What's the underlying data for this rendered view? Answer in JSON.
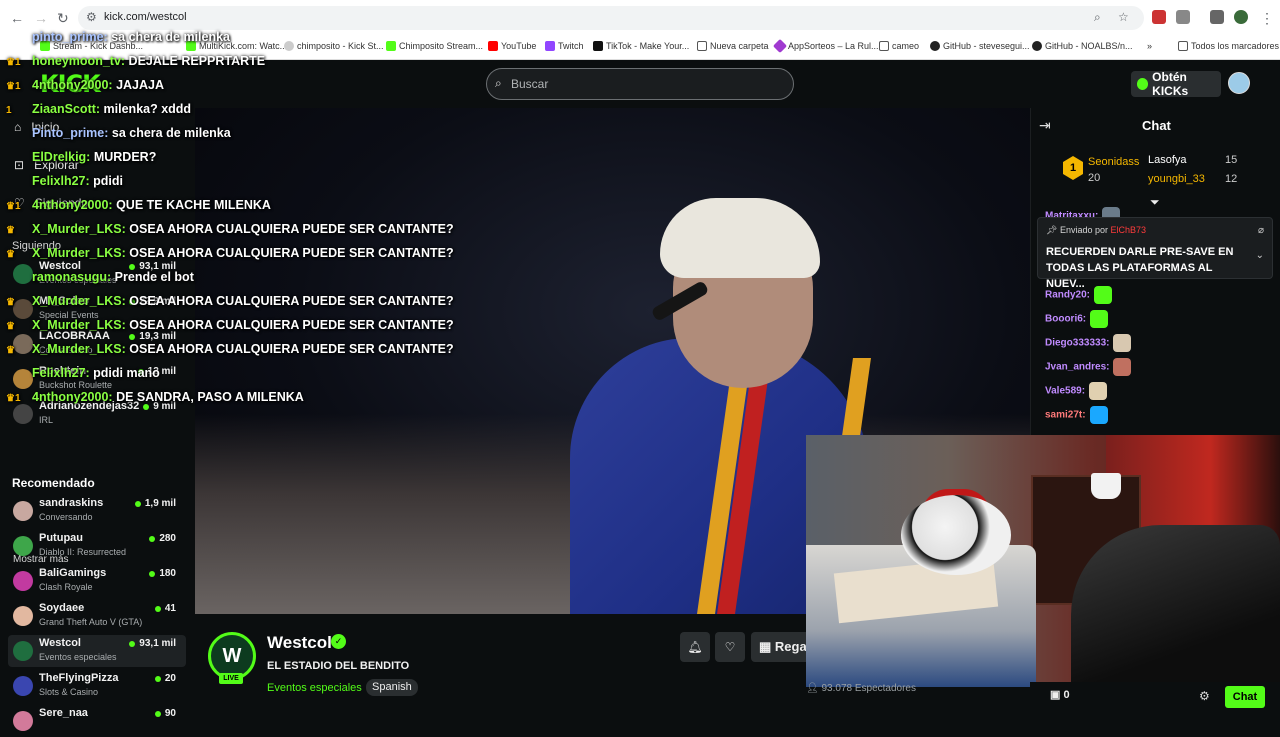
{
  "browser": {
    "url": "kick.com/westcol",
    "bookmarks": [
      "Stream - Kick Dashb...",
      "MultiKick.com: Watc...",
      "chimposito - Kick St...",
      "Chimposito Stream...",
      "YouTube",
      "Twitch",
      "TikTok - Make Your...",
      "Nueva carpeta",
      "AppSorteos – La Rul...",
      "cameo",
      "GitHub - stevesegui...",
      "GitHub - NOALBS/n...",
      "Todos los marcadores"
    ]
  },
  "header": {
    "logo": "KICK",
    "search_placeholder": "Buscar",
    "get_kicks_label": "Obtén KICKs"
  },
  "sidebar": {
    "nav": [
      {
        "label": "Inicio",
        "icon": "home-icon"
      },
      {
        "label": "Explorar",
        "icon": "explore-icon"
      },
      {
        "label": "Siguiendo",
        "icon": "heart-icon"
      }
    ],
    "following_heading": "Siguiendo",
    "following": [
      {
        "name": "Westcol",
        "category": "Eventos especiales",
        "viewers": "93,1 mil",
        "color": "#1f6e3f"
      },
      {
        "name": "Mr_Soloo",
        "category": "Special Events",
        "viewers": "22,9 mil",
        "color": "#5a4a3a"
      },
      {
        "name": "LACOBRAAA",
        "category": "Conversando",
        "viewers": "19,3 mil",
        "color": "#7a6a5a"
      },
      {
        "name": "Roshtein",
        "category": "Buckshot Roulette",
        "viewers": "12 mil",
        "color": "#b5843a"
      },
      {
        "name": "Adrianozendejas32",
        "category": "IRL",
        "viewers": "9 mil",
        "color": "#444"
      }
    ],
    "show_more": "Mostrar más",
    "recommended_heading": "Recomendado",
    "recommended": [
      {
        "name": "sandraskins",
        "category": "Conversando",
        "viewers": "1,9 mil",
        "color": "#c8a8a0",
        "selected": false
      },
      {
        "name": "Putupau",
        "category": "Diablo II: Resurrected",
        "viewers": "280",
        "color": "#3ea64a",
        "selected": false
      },
      {
        "name": "BaliGamings",
        "category": "Clash Royale",
        "viewers": "180",
        "color": "#c23aa0",
        "selected": false
      },
      {
        "name": "Soydaee",
        "category": "Grand Theft Auto V (GTA)",
        "viewers": "41",
        "color": "#e2b8a0",
        "selected": false
      },
      {
        "name": "Westcol",
        "category": "Eventos especiales",
        "viewers": "93,1 mil",
        "color": "#1f6e3f",
        "selected": true
      },
      {
        "name": "TheFlyingPizza",
        "category": "Slots & Casino",
        "viewers": "20",
        "color": "#3a46b0",
        "selected": false
      },
      {
        "name": "Sere_naa",
        "category": "",
        "viewers": "90",
        "color": "#d27a9a",
        "selected": false
      }
    ]
  },
  "overlay_chat": [
    {
      "user": "pinto_prime:",
      "msg": "sa chera de milenka",
      "badges": "",
      "blue": true
    },
    {
      "user": "honeymoon_tv:",
      "msg": "DEJALE REPPRTARTE",
      "badges": "♛1",
      "blue": false
    },
    {
      "user": "4nthony2000:",
      "msg": "JAJAJA",
      "badges": "♛1",
      "blue": false
    },
    {
      "user": "ZiaanScott:",
      "msg": "milenka? xddd",
      "badges": "1",
      "blue": false
    },
    {
      "user": "Pinto_prime:",
      "msg": "sa chera de milenka",
      "badges": "",
      "blue": true
    },
    {
      "user": "ElDrelkig:",
      "msg": "MURDER?",
      "badges": "",
      "blue": false
    },
    {
      "user": "Felixlh27:",
      "msg": "pdidi",
      "badges": "",
      "blue": false
    },
    {
      "user": "4nthony2000:",
      "msg": "QUE TE KACHE MILENKA",
      "badges": "♛1",
      "blue": false
    },
    {
      "user": "X_Murder_LKS:",
      "msg": "OSEA AHORA CUALQUIERA PUEDE SER CANTANTE?",
      "badges": "♛",
      "blue": false
    },
    {
      "user": "X_Murder_LKS:",
      "msg": "OSEA AHORA CUALQUIERA PUEDE SER CANTANTE?",
      "badges": "♛",
      "blue": false
    },
    {
      "user": "ramonasugu:",
      "msg": "Prende el bot",
      "badges": "",
      "blue": false
    },
    {
      "user": "X_Murder_LKS:",
      "msg": "OSEA AHORA CUALQUIERA PUEDE SER CANTANTE?",
      "badges": "♛",
      "blue": false
    },
    {
      "user": "X_Murder_LKS:",
      "msg": "OSEA AHORA CUALQUIERA PUEDE SER CANTANTE?",
      "badges": "♛",
      "blue": false
    },
    {
      "user": "X_Murder_LKS:",
      "msg": "OSEA AHORA CUALQUIERA PUEDE SER CANTANTE?",
      "badges": "♛",
      "blue": false
    },
    {
      "user": "Felixlh27:",
      "msg": "pdidi mano",
      "badges": "",
      "blue": false
    },
    {
      "user": "4nthony2000:",
      "msg": "DE SANDRA, PASO A MILENKA",
      "badges": "♛1",
      "blue": false
    }
  ],
  "stream": {
    "avatar_letters": "W",
    "live_label": "LIVE",
    "streamer": "Westcol",
    "title": "EL ESTADIO DEL BENDITO",
    "category": "Eventos especiales",
    "language": "Spanish",
    "gift_label": "Regalar",
    "viewers_text": "93.078 Espectadores"
  },
  "chat": {
    "title": "Chat",
    "top_gifters": [
      {
        "rank": "1",
        "name": "Seonidass",
        "value": "20"
      },
      {
        "name": "Lasofya",
        "value": "15"
      },
      {
        "name": "youngbi_33",
        "value": "12"
      }
    ],
    "pinned_by_prefix": "Enviado por",
    "pinned_by_name": "ElChB73",
    "pinned_text": "RECUERDEN DARLE PRE-SAVE EN TODAS LAS PLATAFORMAS AL NUEV...",
    "messages": [
      {
        "user": "Matritaxxu:",
        "color": "#c08bff",
        "emote": "#6a7b8a"
      },
      {
        "user": "Randy20:",
        "color": "#c08bff",
        "emote": "#53fc18"
      },
      {
        "user": "Booori6:",
        "color": "#c08bff",
        "emote": "#53fc18"
      },
      {
        "user": "Diego333333:",
        "color": "#c08bff",
        "emote": "#d8c8b0"
      },
      {
        "user": "Jvan_andres:",
        "color": "#c08bff",
        "emote": "#c07060"
      },
      {
        "user": "Vale589:",
        "color": "#c08bff",
        "emote": "#e0d0b0"
      },
      {
        "user": "sami27t:",
        "color": "#ff7a7a",
        "emote": "#1aa8ff"
      }
    ],
    "gift_count": "0",
    "chat_button": "Chat"
  }
}
